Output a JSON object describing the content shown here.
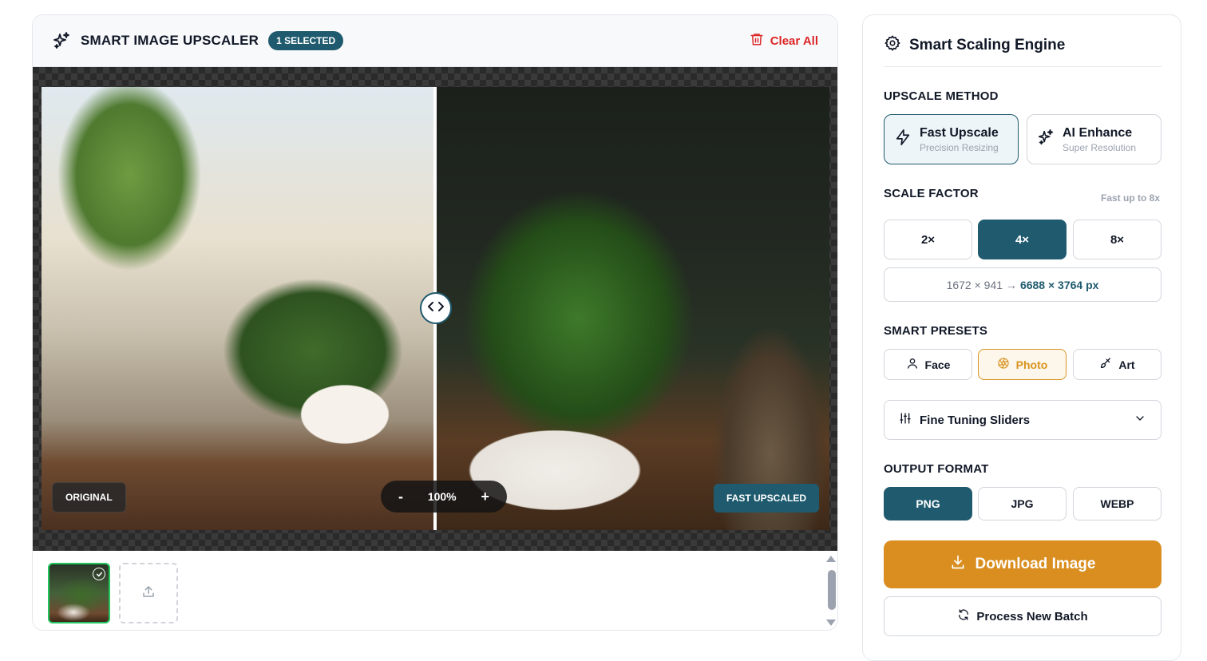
{
  "app": {
    "title": "SMART IMAGE UPSCALER",
    "selected_badge": "1 SELECTED",
    "clear_label": "Clear All"
  },
  "viewer": {
    "original_label": "ORIGINAL",
    "upscaled_label": "FAST UPSCALED",
    "zoom_minus": "-",
    "zoom_value": "100%",
    "zoom_plus": "+",
    "comparison_split": 0.5
  },
  "panel": {
    "title": "Smart Scaling Engine",
    "method_label": "UPSCALE METHOD",
    "methods": [
      {
        "title": "Fast Upscale",
        "subtitle": "Precision Resizing",
        "active": true
      },
      {
        "title": "AI Enhance",
        "subtitle": "Super Resolution",
        "active": false
      }
    ],
    "scale_label": "SCALE FACTOR",
    "scale_hint": "Fast up to 8x",
    "scales": [
      "2×",
      "4×",
      "8×"
    ],
    "scale_active": "4×",
    "dims_from": "1672 × 941 →",
    "dims_to": "6688 × 3764 px",
    "presets_label": "SMART PRESETS",
    "presets": [
      "Face",
      "Photo",
      "Art"
    ],
    "preset_active": "Photo",
    "fine_tuning_label": "Fine Tuning Sliders",
    "format_label": "OUTPUT FORMAT",
    "formats": [
      "PNG",
      "JPG",
      "WEBP"
    ],
    "format_active": "PNG",
    "download_label": "Download Image",
    "batch_label": "Process New Batch"
  },
  "colors": {
    "accent": "#1f5a6e",
    "download": "#d98e1f",
    "danger": "#dc2626",
    "preset_active": "#d89320",
    "thumb_selected": "#22c55e"
  }
}
